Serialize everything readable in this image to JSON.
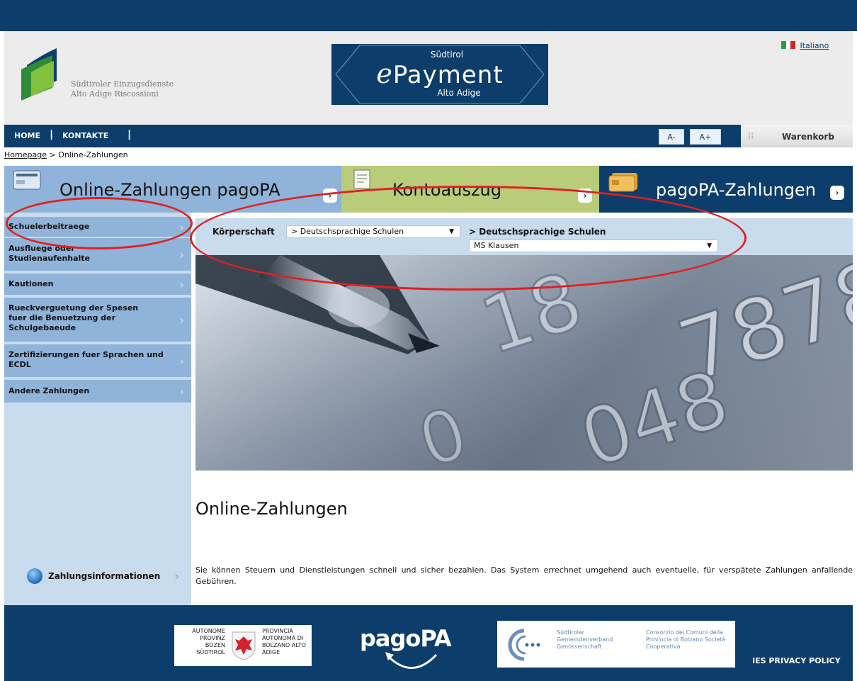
{
  "header": {
    "logo_line1": "Südtiroler Einzugsdienste",
    "logo_line2": "Alto Adige Riscossioni",
    "epay_top": "Südtirol",
    "epay_e": "e",
    "epay_main": "Payment",
    "epay_bottom": "Alto Adige",
    "language": "Italiano"
  },
  "nav": {
    "home": "HOME",
    "contacts": "KONTAKTE",
    "font_smaller": "A-",
    "font_larger": "A+",
    "cart": "Warenkorb"
  },
  "breadcrumb": {
    "home": "Homepage",
    "separator": ">",
    "current": "Online-Zahlungen"
  },
  "tabs": [
    {
      "label": "Online-Zahlungen pagoPA",
      "color": "#8fb3d9"
    },
    {
      "label": "Kontoauszug",
      "color": "#b8cc7a"
    },
    {
      "label": "pagoPA-Zahlungen",
      "color": "#0c3d6b"
    }
  ],
  "sidebar": {
    "items": [
      {
        "label": "Schuelerbeitraege"
      },
      {
        "label": "Ausfluege oder Studienaufenhalte"
      },
      {
        "label": "Kautionen"
      },
      {
        "label": "Rueckverguetung der Spesen fuer die Benuetzung der Schulgebaeude"
      },
      {
        "label": "Zertifizierungen fuer Sprachen und ECDL"
      },
      {
        "label": "Andere Zahlungen"
      }
    ],
    "info_label": "Zahlungsinformationen"
  },
  "filter": {
    "label": "Körperschaft",
    "entity_value": "> Deutschsprachige Schulen",
    "path": "> Deutschsprachige Schulen",
    "school_value": "MS Klausen"
  },
  "content": {
    "title": "Online-Zahlungen",
    "text": "Sie können Steuern und Dienstleistungen schnell und sicher bezahlen. Das System errechnet umgehend auch eventuelle, für verspätete Zahlungen anfallende Gebühren."
  },
  "footer": {
    "prov_de": "AUTONOME PROVINZ BOZEN SÜDTIROL",
    "prov_it": "PROVINCIA AUTONOMA DI BOLZANO ALTO ADIGE",
    "pagopa": "pagoPA",
    "gem_de": "Südtiroler Gemeindenverband Genossenschaft",
    "gem_it": "Consorzio dei Comuni della Provincia di Bolzano Società Cooperativa",
    "policy": "IES PRIVACY POLICY"
  },
  "colors": {
    "brand_navy": "#0c3d6b",
    "sidebar_blue": "#8fb3d9",
    "annotation_red": "#e02020"
  }
}
